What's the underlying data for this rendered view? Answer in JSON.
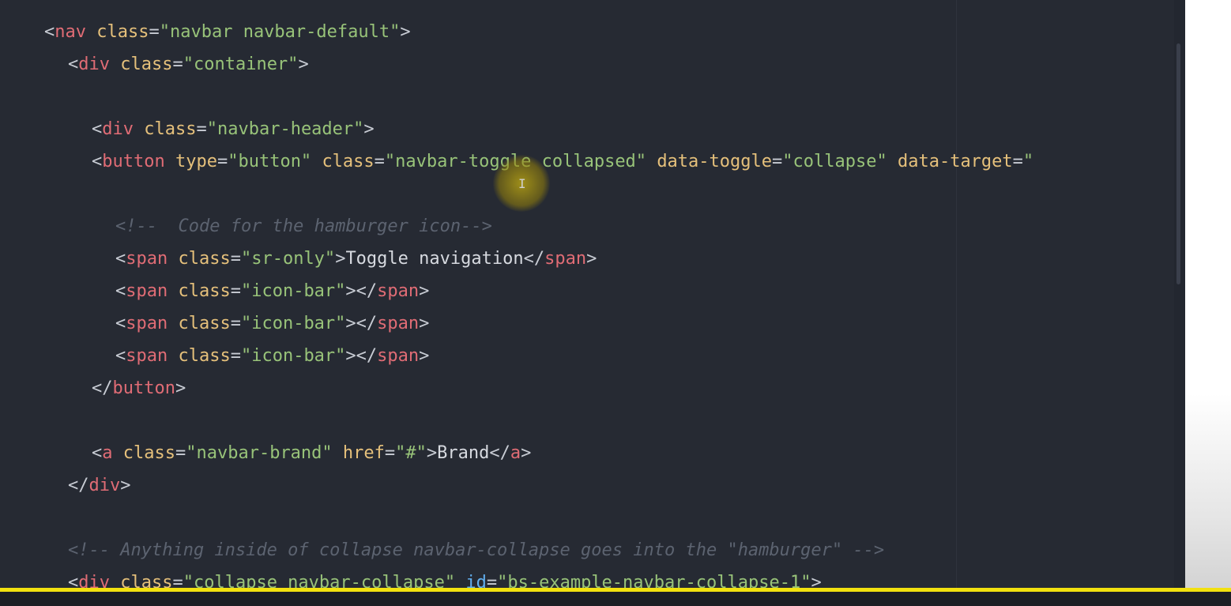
{
  "editor": {
    "lines": [
      [
        {
          "c": "punct",
          "t": "<"
        },
        {
          "c": "tag",
          "t": "nav"
        },
        {
          "c": "text",
          "t": " "
        },
        {
          "c": "attr",
          "t": "class"
        },
        {
          "c": "punct",
          "t": "="
        },
        {
          "c": "str",
          "t": "\"navbar navbar-default\""
        },
        {
          "c": "punct",
          "t": ">"
        }
      ],
      [
        {
          "c": "punct",
          "t": "<"
        },
        {
          "c": "tag",
          "t": "div"
        },
        {
          "c": "text",
          "t": " "
        },
        {
          "c": "attr",
          "t": "class"
        },
        {
          "c": "punct",
          "t": "="
        },
        {
          "c": "str",
          "t": "\"container\""
        },
        {
          "c": "punct",
          "t": ">"
        }
      ],
      [],
      [
        {
          "c": "punct",
          "t": "<"
        },
        {
          "c": "tag",
          "t": "div"
        },
        {
          "c": "text",
          "t": " "
        },
        {
          "c": "attr",
          "t": "class"
        },
        {
          "c": "punct",
          "t": "="
        },
        {
          "c": "str",
          "t": "\"navbar-header\""
        },
        {
          "c": "punct",
          "t": ">"
        }
      ],
      [
        {
          "c": "punct",
          "t": "<"
        },
        {
          "c": "tag",
          "t": "button"
        },
        {
          "c": "text",
          "t": " "
        },
        {
          "c": "attr",
          "t": "type"
        },
        {
          "c": "punct",
          "t": "="
        },
        {
          "c": "str",
          "t": "\"button\""
        },
        {
          "c": "text",
          "t": " "
        },
        {
          "c": "attr",
          "t": "class"
        },
        {
          "c": "punct",
          "t": "="
        },
        {
          "c": "str",
          "t": "\"navbar-toggle collapsed\""
        },
        {
          "c": "text",
          "t": " "
        },
        {
          "c": "attr",
          "t": "data-toggle"
        },
        {
          "c": "punct",
          "t": "="
        },
        {
          "c": "str",
          "t": "\"collapse\""
        },
        {
          "c": "text",
          "t": " "
        },
        {
          "c": "attr",
          "t": "data-target"
        },
        {
          "c": "punct",
          "t": "="
        },
        {
          "c": "str",
          "t": "\""
        }
      ],
      [],
      [
        {
          "c": "comment",
          "t": "<!--  Code for the hamburger icon-->"
        }
      ],
      [
        {
          "c": "punct",
          "t": "<"
        },
        {
          "c": "tag",
          "t": "span"
        },
        {
          "c": "text",
          "t": " "
        },
        {
          "c": "attr",
          "t": "class"
        },
        {
          "c": "punct",
          "t": "="
        },
        {
          "c": "str",
          "t": "\"sr-only\""
        },
        {
          "c": "punct",
          "t": ">"
        },
        {
          "c": "text",
          "t": "Toggle navigation"
        },
        {
          "c": "punct",
          "t": "</"
        },
        {
          "c": "tag",
          "t": "span"
        },
        {
          "c": "punct",
          "t": ">"
        }
      ],
      [
        {
          "c": "punct",
          "t": "<"
        },
        {
          "c": "tag",
          "t": "span"
        },
        {
          "c": "text",
          "t": " "
        },
        {
          "c": "attr",
          "t": "class"
        },
        {
          "c": "punct",
          "t": "="
        },
        {
          "c": "str",
          "t": "\"icon-bar\""
        },
        {
          "c": "punct",
          "t": "></"
        },
        {
          "c": "tag",
          "t": "span"
        },
        {
          "c": "punct",
          "t": ">"
        }
      ],
      [
        {
          "c": "punct",
          "t": "<"
        },
        {
          "c": "tag",
          "t": "span"
        },
        {
          "c": "text",
          "t": " "
        },
        {
          "c": "attr",
          "t": "class"
        },
        {
          "c": "punct",
          "t": "="
        },
        {
          "c": "str",
          "t": "\"icon-bar\""
        },
        {
          "c": "punct",
          "t": "></"
        },
        {
          "c": "tag",
          "t": "span"
        },
        {
          "c": "punct",
          "t": ">"
        }
      ],
      [
        {
          "c": "punct",
          "t": "<"
        },
        {
          "c": "tag",
          "t": "span"
        },
        {
          "c": "text",
          "t": " "
        },
        {
          "c": "attr",
          "t": "class"
        },
        {
          "c": "punct",
          "t": "="
        },
        {
          "c": "str",
          "t": "\"icon-bar\""
        },
        {
          "c": "punct",
          "t": "></"
        },
        {
          "c": "tag",
          "t": "span"
        },
        {
          "c": "punct",
          "t": ">"
        }
      ],
      [
        {
          "c": "punct",
          "t": "</"
        },
        {
          "c": "tag",
          "t": "button"
        },
        {
          "c": "punct",
          "t": ">"
        }
      ],
      [],
      [
        {
          "c": "punct",
          "t": "<"
        },
        {
          "c": "tag",
          "t": "a"
        },
        {
          "c": "text",
          "t": " "
        },
        {
          "c": "attr",
          "t": "class"
        },
        {
          "c": "punct",
          "t": "="
        },
        {
          "c": "str",
          "t": "\"navbar-brand\""
        },
        {
          "c": "text",
          "t": " "
        },
        {
          "c": "attr",
          "t": "href"
        },
        {
          "c": "punct",
          "t": "="
        },
        {
          "c": "str",
          "t": "\"#\""
        },
        {
          "c": "punct",
          "t": ">"
        },
        {
          "c": "text",
          "t": "Brand"
        },
        {
          "c": "punct",
          "t": "</"
        },
        {
          "c": "tag",
          "t": "a"
        },
        {
          "c": "punct",
          "t": ">"
        }
      ],
      [
        {
          "c": "punct",
          "t": "</"
        },
        {
          "c": "tag",
          "t": "div"
        },
        {
          "c": "punct",
          "t": ">"
        }
      ],
      [],
      [
        {
          "c": "comment",
          "t": "<!-- Anything inside of collapse navbar-collapse goes into the \"hamburger\" -->"
        }
      ],
      [
        {
          "c": "punct",
          "t": "<"
        },
        {
          "c": "tag",
          "t": "div"
        },
        {
          "c": "text",
          "t": " "
        },
        {
          "c": "attr",
          "t": "class"
        },
        {
          "c": "punct",
          "t": "="
        },
        {
          "c": "str",
          "t": "\"collapse navbar-collapse\""
        },
        {
          "c": "text",
          "t": " "
        },
        {
          "c": "id",
          "t": "id"
        },
        {
          "c": "punct",
          "t": "="
        },
        {
          "c": "str",
          "t": "\"bs-example-navbar-collapse-1\""
        },
        {
          "c": "punct",
          "t": ">"
        }
      ]
    ],
    "indent_levels": [
      0,
      1,
      1,
      2,
      2,
      2,
      3,
      3,
      3,
      3,
      3,
      2,
      2,
      2,
      1,
      1,
      1,
      1
    ]
  },
  "cursor_icon": "text-ibeam-icon",
  "video_progress": {
    "fraction": 1.0,
    "color": "#f2e10f"
  }
}
